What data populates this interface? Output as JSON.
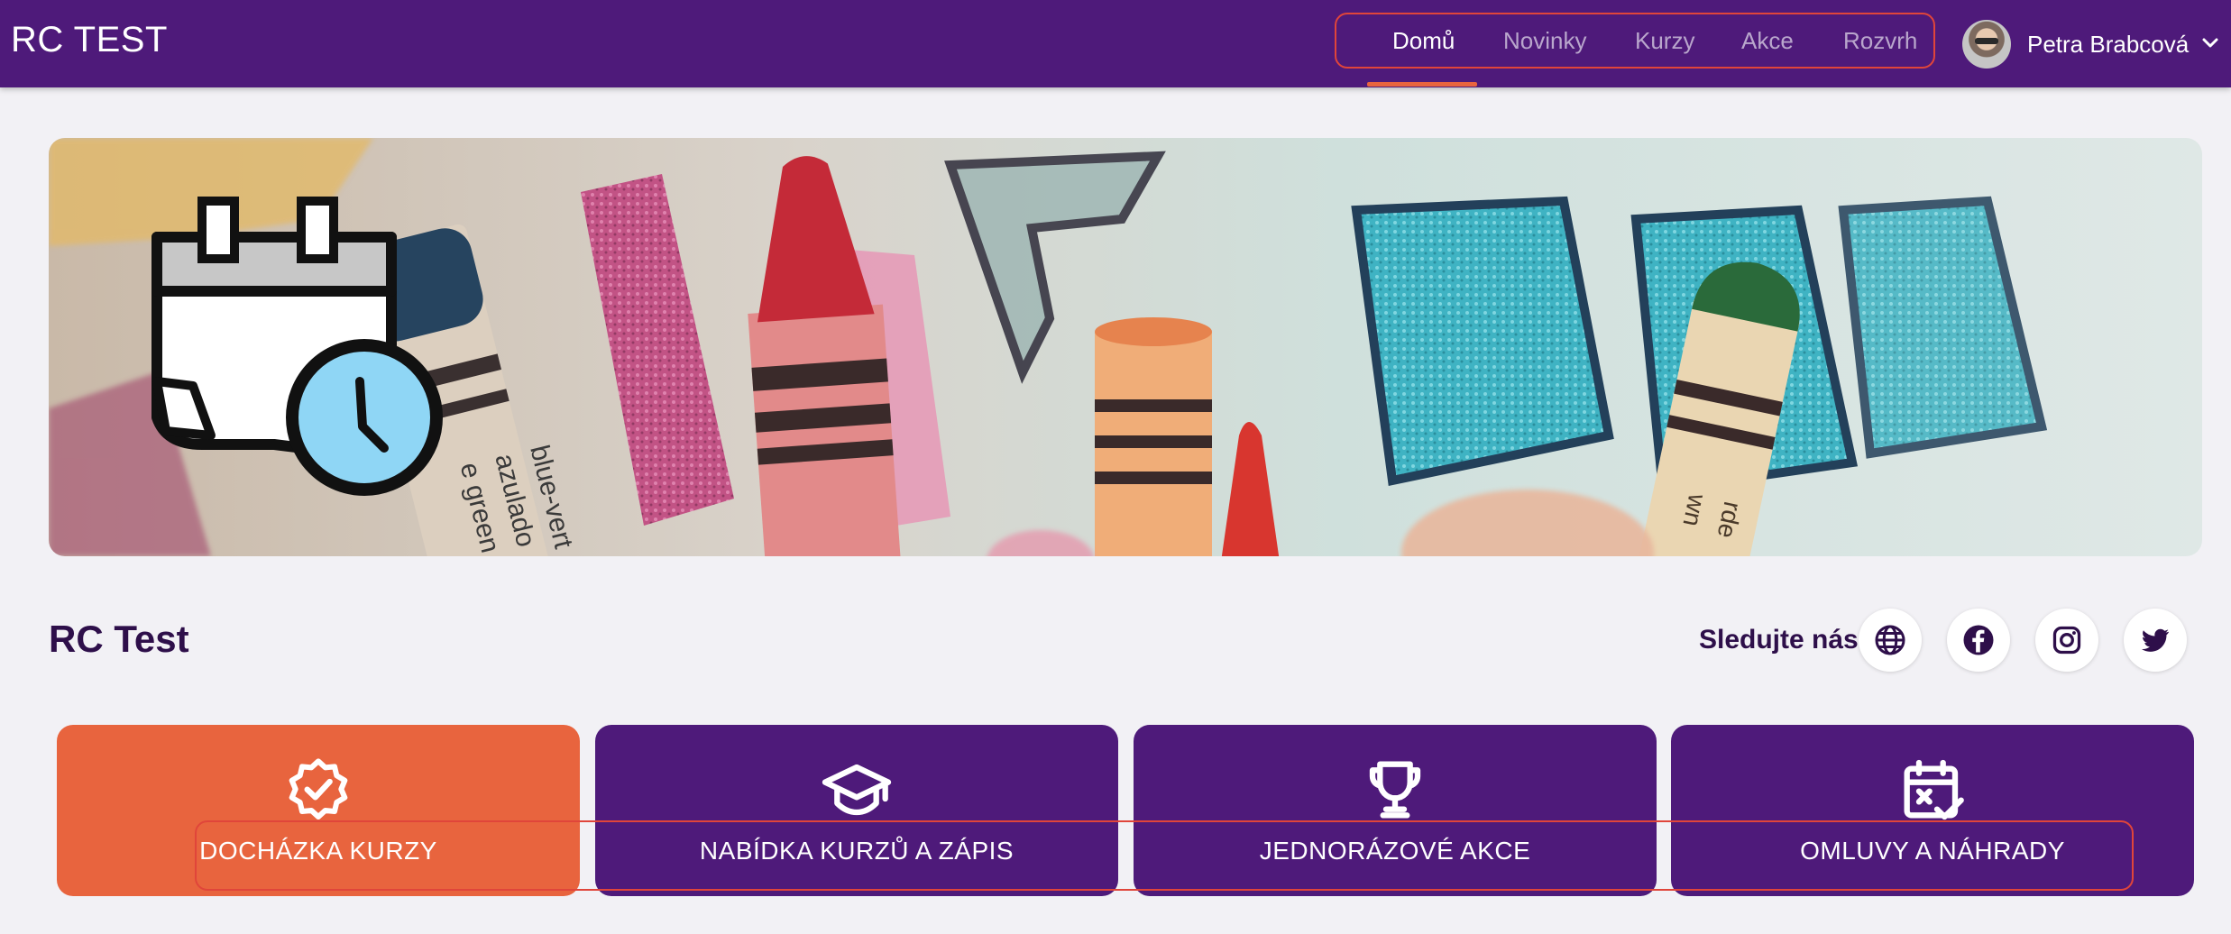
{
  "app": {
    "title": "RC TEST"
  },
  "nav": {
    "items": [
      {
        "label": "Domů",
        "active": true
      },
      {
        "label": "Novinky",
        "active": false
      },
      {
        "label": "Kurzy",
        "active": false
      },
      {
        "label": "Akce",
        "active": false
      },
      {
        "label": "Rozvrh",
        "active": false
      }
    ]
  },
  "user": {
    "name": "Petra Brabcová",
    "avatar_icon": "user-avatar-photo",
    "menu_icon": "chevron-down-icon"
  },
  "banner": {
    "image": "crayons-photo",
    "overlay_icon": "calendar-clock-icon",
    "crayon_texts": [
      "e green",
      "azulado",
      "blue-vert",
      "wn",
      "rde"
    ]
  },
  "page": {
    "title": "RC Test"
  },
  "social": {
    "label": "Sledujte nás:",
    "icons": [
      "globe-icon",
      "facebook-icon",
      "instagram-icon",
      "twitter-icon"
    ]
  },
  "tiles": [
    {
      "label": "DOCHÁZKA KURZY",
      "icon": "badge-check-icon",
      "color": "#e8643e"
    },
    {
      "label": "NABÍDKA KURZŮ A ZÁPIS",
      "icon": "graduation-cap-icon",
      "color": "#4e1a7a"
    },
    {
      "label": "JEDNORÁZOVÉ AKCE",
      "icon": "trophy-icon",
      "color": "#4e1a7a"
    },
    {
      "label": "OMLUVY A NÁHRADY",
      "icon": "calendar-x-icon",
      "color": "#4e1a7a"
    }
  ],
  "colors": {
    "primary": "#4e1a7a",
    "accent": "#e8643e",
    "background": "#f2f1f5",
    "highlight_frame": "#e0453a"
  }
}
